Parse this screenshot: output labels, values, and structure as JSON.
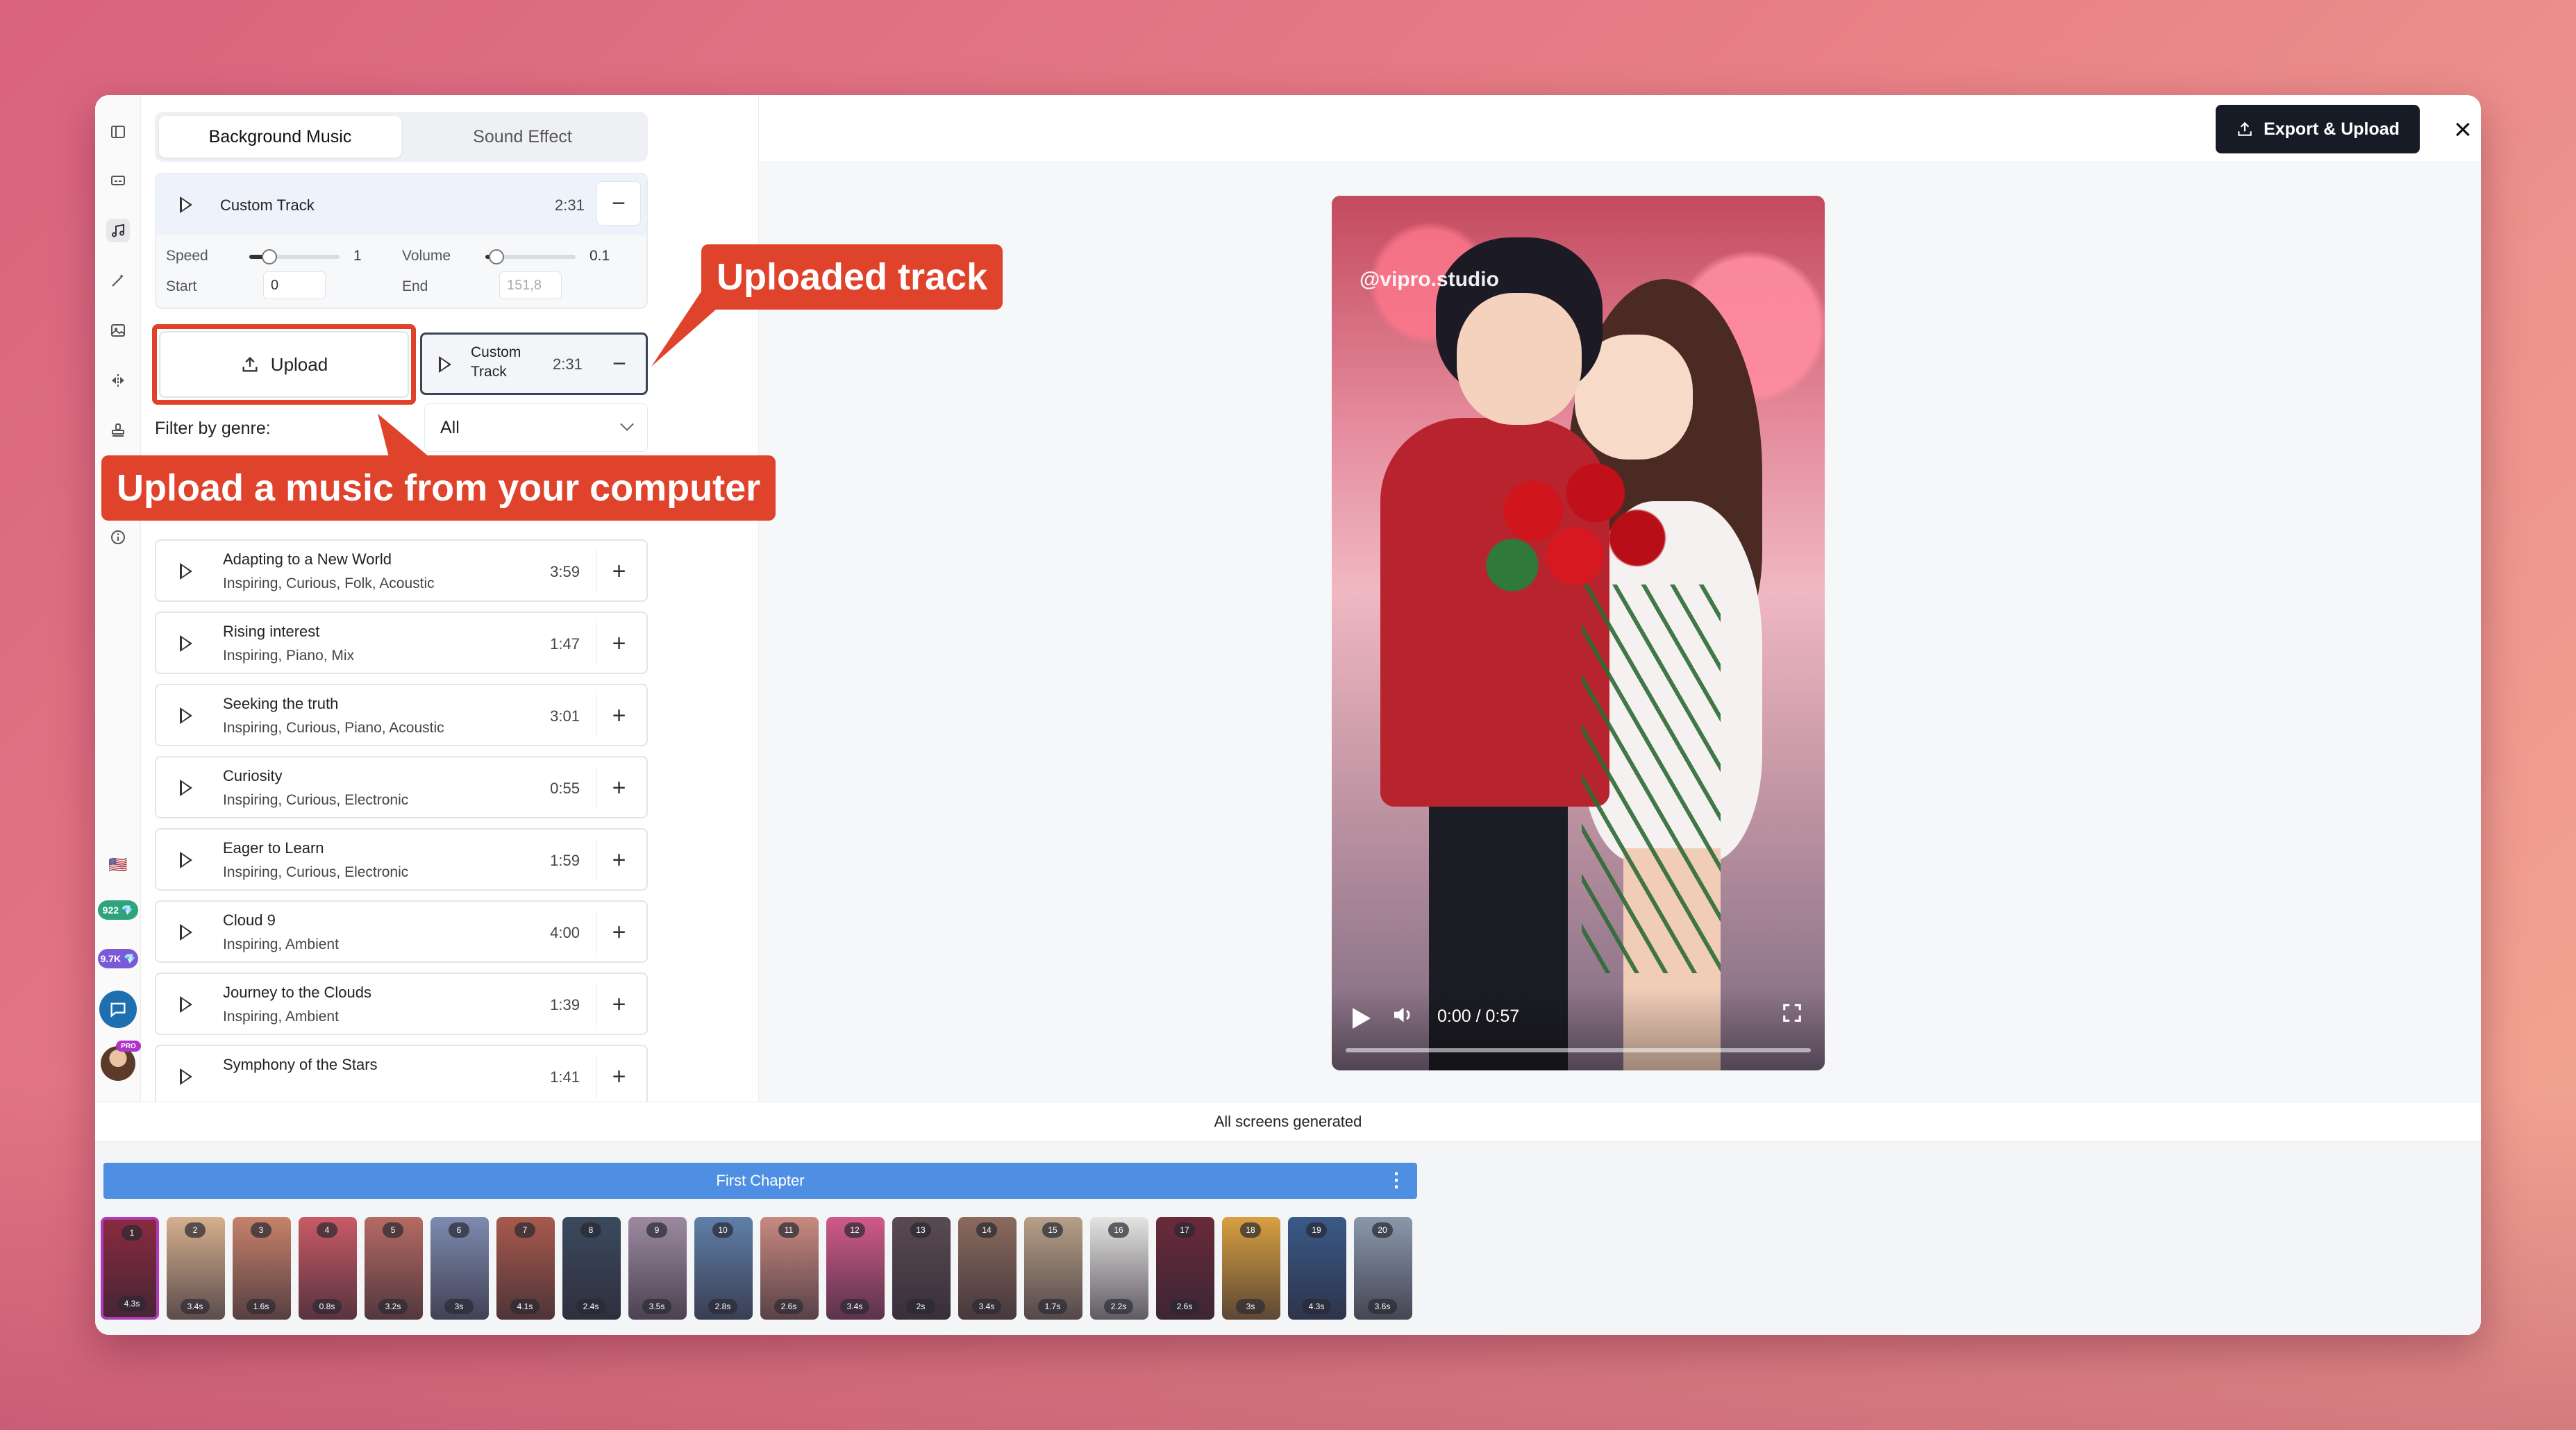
{
  "colors": {
    "accent": "#4f8fe3",
    "callout": "#e0432c",
    "export_button": "#161b26",
    "selected_thumb": "#b13ab8"
  },
  "rail": {
    "icons": [
      "sidebar-toggle-icon",
      "caption-icon",
      "music-icon",
      "magic-wand-icon",
      "image-icon",
      "flip-icon",
      "stamp-icon",
      "info-icon"
    ],
    "flag": "🇺🇸",
    "credits_1": "922 💎",
    "credits_2": "9.7K 💎",
    "pro_badge": "PRO"
  },
  "panel": {
    "tabs": [
      {
        "label": "Background Music"
      },
      {
        "label": "Sound Effect"
      }
    ],
    "custom_track": {
      "title": "Custom Track",
      "duration": "2:31",
      "speed_label": "Speed",
      "speed_value": "1",
      "speed_level": 0.2,
      "volume_label": "Volume",
      "volume_value": "0.1",
      "volume_level": 0.1,
      "start_label": "Start",
      "start_value": "0",
      "end_label": "End",
      "end_value": "151,8"
    },
    "upload_label": "Upload",
    "uploaded_card": {
      "title_line1": "Custom",
      "title_line2": "Track",
      "duration": "2:31"
    },
    "genre_label": "Filter by genre:",
    "genre_value": "All",
    "tracks": [
      {
        "name": "Adapting to a New World",
        "tags": "Inspiring, Curious, Folk, Acoustic",
        "duration": "3:59"
      },
      {
        "name": "Rising interest",
        "tags": "Inspiring, Piano, Mix",
        "duration": "1:47"
      },
      {
        "name": "Seeking the truth",
        "tags": "Inspiring, Curious, Piano, Acoustic",
        "duration": "3:01"
      },
      {
        "name": "Curiosity",
        "tags": "Inspiring, Curious, Electronic",
        "duration": "0:55"
      },
      {
        "name": "Eager to Learn",
        "tags": "Inspiring, Curious, Electronic",
        "duration": "1:59"
      },
      {
        "name": "Cloud 9",
        "tags": "Inspiring, Ambient",
        "duration": "4:00"
      },
      {
        "name": "Journey to the Clouds",
        "tags": "Inspiring, Ambient",
        "duration": "1:39"
      },
      {
        "name": "Symphony of the Stars",
        "tags": "",
        "duration": "1:41"
      }
    ]
  },
  "callouts": {
    "uploaded_track": "Uploaded track",
    "upload_hint": "Upload a music from your computer"
  },
  "header": {
    "export_label": "Export & Upload",
    "close_icon": "×"
  },
  "preview": {
    "watermark": "@vipro.studio",
    "time": "0:00 / 0:57"
  },
  "status": "All screens generated",
  "timeline": {
    "chapter_title": "First Chapter",
    "chapter_menu": "⋮",
    "thumbs": [
      {
        "num": "1",
        "dur": "4.3s",
        "color": "#8a2a40"
      },
      {
        "num": "2",
        "dur": "3.4s",
        "color": "#d6b08e"
      },
      {
        "num": "3",
        "dur": "1.6s",
        "color": "#c7826a"
      },
      {
        "num": "4",
        "dur": "0.8s",
        "color": "#c95a66"
      },
      {
        "num": "5",
        "dur": "3.2s",
        "color": "#b66a62"
      },
      {
        "num": "6",
        "dur": "3s",
        "color": "#7d8bb0"
      },
      {
        "num": "7",
        "dur": "4.1s",
        "color": "#a85a4c"
      },
      {
        "num": "8",
        "dur": "2.4s",
        "color": "#3b4a5e"
      },
      {
        "num": "9",
        "dur": "3.5s",
        "color": "#9d8aa2"
      },
      {
        "num": "10",
        "dur": "2.8s",
        "color": "#5f7fa8"
      },
      {
        "num": "11",
        "dur": "2.6s",
        "color": "#c98a80"
      },
      {
        "num": "12",
        "dur": "3.4s",
        "color": "#d05a8a"
      },
      {
        "num": "13",
        "dur": "2s",
        "color": "#5a4a52"
      },
      {
        "num": "14",
        "dur": "3.4s",
        "color": "#8a6a5c"
      },
      {
        "num": "15",
        "dur": "1.7s",
        "color": "#b8a088"
      },
      {
        "num": "16",
        "dur": "2.2s",
        "color": "#e6e4e2"
      },
      {
        "num": "17",
        "dur": "2.6s",
        "color": "#6a2a3a"
      },
      {
        "num": "18",
        "dur": "3s",
        "color": "#d8a040"
      },
      {
        "num": "19",
        "dur": "4.3s",
        "color": "#3a5a88"
      },
      {
        "num": "20",
        "dur": "3.6s",
        "color": "#8a98ac"
      }
    ]
  }
}
